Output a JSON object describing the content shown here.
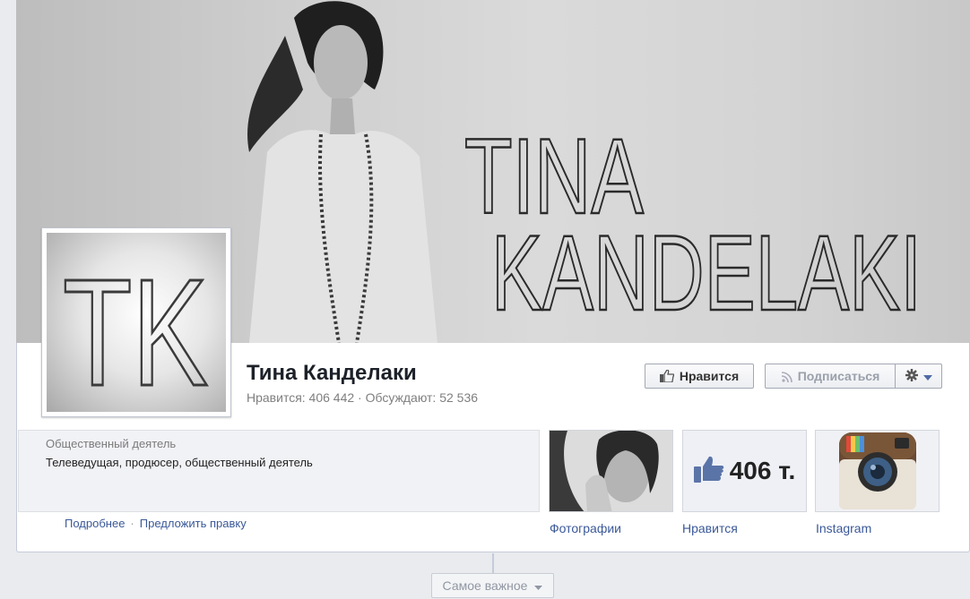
{
  "cover": {
    "title_line1": "TINA",
    "title_line2": "KANDELAKI"
  },
  "profile": {
    "monogram": "TK",
    "name": "Тина Канделаки",
    "stats": "Нравится: 406 442 · Обсуждают: 52 536"
  },
  "actions": {
    "like_label": "Нравится",
    "subscribe_label": "Подписаться"
  },
  "about": {
    "category": "Общественный деятель",
    "description": "Телеведущая, продюсер, общественный деятель",
    "more_link": "Подробнее",
    "separator": "·",
    "suggest_link": "Предложить правку"
  },
  "apps": [
    {
      "label": "Фотографии",
      "icon": "photo-thumbnail"
    },
    {
      "label": "Нравится",
      "icon": "thumbs-up-icon",
      "count": "406 т."
    },
    {
      "label": "Instagram",
      "icon": "instagram-icon"
    }
  ],
  "timeline": {
    "filter_label": "Самое важное"
  },
  "colors": {
    "link": "#3b5998",
    "name": "#1d2129",
    "background": "#e9ebee"
  }
}
